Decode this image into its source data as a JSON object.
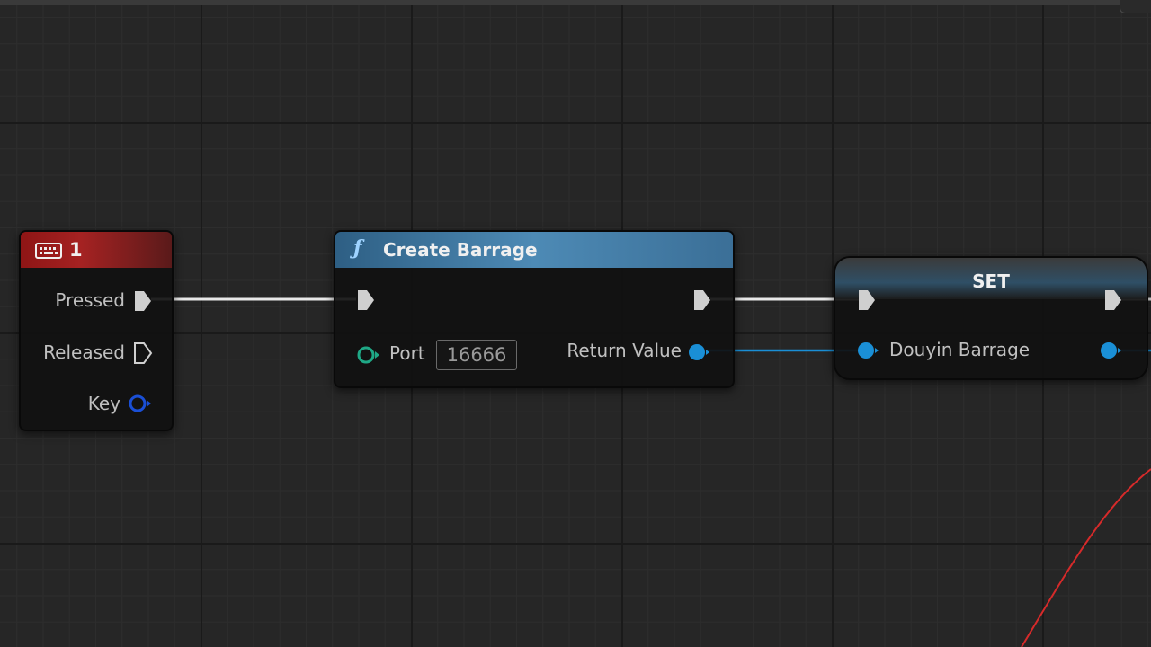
{
  "nodes": {
    "key_event": {
      "title": "1",
      "icon": "keyboard-icon",
      "header_color": "#a52222",
      "pins": {
        "pressed": "Pressed",
        "released": "Released",
        "key": "Key"
      }
    },
    "create_barrage": {
      "title": "Create Barrage",
      "icon": "function-icon",
      "icon_glyph": "ƒ",
      "header_color": "#4d8ab5",
      "pins": {
        "port_label": "Port",
        "port_value": "16666",
        "return_value": "Return Value"
      }
    },
    "set": {
      "title": "SET",
      "pins": {
        "douyin_barrage": "Douyin Barrage"
      }
    }
  },
  "colors": {
    "exec_wire": "#e8e8e8",
    "object_wire": "#1a8fd6",
    "integer_pin": "#1fa886",
    "struct_pin": "#1a4fd6",
    "other_wire": "#d62a2a"
  }
}
